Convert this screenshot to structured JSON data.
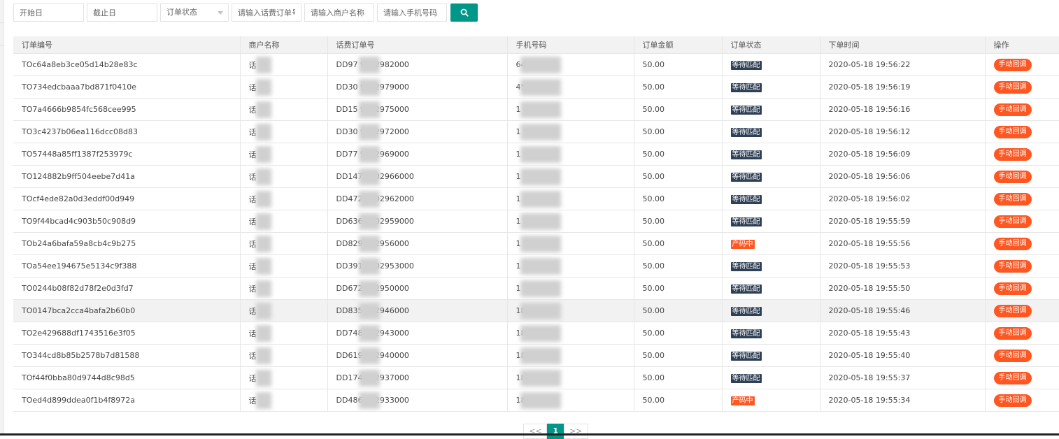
{
  "filters": {
    "start_date_placeholder": "开始日",
    "end_date_placeholder": "截止日",
    "status_select": "订单状态",
    "order_no_placeholder": "请输入话费订单号",
    "merchant_placeholder": "请输入商户名称",
    "phone_placeholder": "请输入手机号码",
    "search_icon": "search-icon"
  },
  "table": {
    "headers": [
      "订单编号",
      "商户名称",
      "话费订单号",
      "手机号码",
      "订单金额",
      "订单状态",
      "下单时间",
      "操作"
    ],
    "rows": [
      {
        "id": "TOc64a8eb3ce05d14b28e83c",
        "merchant": "话",
        "bill": "DD97 9802982000",
        "phone": "6421",
        "amount": "50.00",
        "status": "等待匹配",
        "status_type": "wait",
        "time": "2020-05-18 19:56:22",
        "action": "手动回调"
      },
      {
        "id": "TO734edcbaaa7bd871f0410e",
        "merchant": "话",
        "bill": "DD30 9802979000",
        "phone": "456",
        "amount": "50.00",
        "status": "等待匹配",
        "status_type": "wait",
        "time": "2020-05-18 19:56:19",
        "action": "手动回调"
      },
      {
        "id": "TO7a4666b9854fc568cee995",
        "merchant": "话",
        "bill": "DD15 9802975000",
        "phone": "1 349",
        "amount": "50.00",
        "status": "等待匹配",
        "status_type": "wait",
        "time": "2020-05-18 19:56:16",
        "action": "手动回调"
      },
      {
        "id": "TO3c4237b06ea116dcc08d83",
        "merchant": "话",
        "bill": "DD30 9802972000",
        "phone": "1 985",
        "amount": "50.00",
        "status": "等待匹配",
        "status_type": "wait",
        "time": "2020-05-18 19:56:12",
        "action": "手动回调"
      },
      {
        "id": "TO57448a85ff1387f253979c",
        "merchant": "话",
        "bill": "DD77 9802969000",
        "phone": "1 020",
        "amount": "50.00",
        "status": "等待匹配",
        "status_type": "wait",
        "time": "2020-05-18 19:56:09",
        "action": "手动回调"
      },
      {
        "id": "TO124882b9ff504eebe7d41a",
        "merchant": "话",
        "bill": "DD147 9802966000",
        "phone": "1 332",
        "amount": "50.00",
        "status": "等待匹配",
        "status_type": "wait",
        "time": "2020-05-18 19:56:06",
        "action": "手动回调"
      },
      {
        "id": "TOcf4ede82a0d3eddf00d949",
        "merchant": "话",
        "bill": "DD472 9802962000",
        "phone": "1 43",
        "amount": "50.00",
        "status": "等待匹配",
        "status_type": "wait",
        "time": "2020-05-18 19:56:02",
        "action": "手动回调"
      },
      {
        "id": "TO9f44bcad4c903b50c908d9",
        "merchant": "话",
        "bill": "DD636 9802959000",
        "phone": "1 28",
        "amount": "50.00",
        "status": "等待匹配",
        "status_type": "wait",
        "time": "2020-05-18 19:55:59",
        "action": "手动回调"
      },
      {
        "id": "TOb24a6bafa59a8cb4c9b275",
        "merchant": "话",
        "bill": "DD829 802956000",
        "phone": "1 5",
        "amount": "50.00",
        "status": "产码中",
        "status_type": "risk",
        "time": "2020-05-18 19:55:56",
        "action": "手动回调"
      },
      {
        "id": "TOa54ee194675e5134c9f388",
        "merchant": "话",
        "bill": "DD3915 802953000",
        "phone": "1 5",
        "amount": "50.00",
        "status": "等待匹配",
        "status_type": "wait",
        "time": "2020-05-18 19:55:53",
        "action": "手动回调"
      },
      {
        "id": "TO0244b08f82d78f2e0d3fd7",
        "merchant": "话",
        "bill": "DD672 802950000",
        "phone": "1",
        "amount": "50.00",
        "status": "等待匹配",
        "status_type": "wait",
        "time": "2020-05-18 19:55:50",
        "action": "手动回调"
      },
      {
        "id": "TO0147bca2cca4bafa2b60b0",
        "merchant": "话",
        "bill": "DD835 802946000",
        "phone": "18",
        "amount": "50.00",
        "status": "等待匹配",
        "status_type": "wait",
        "time": "2020-05-18 19:55:46",
        "action": "手动回调"
      },
      {
        "id": "TO2e429688df1743516e3f05",
        "merchant": "话",
        "bill": "DD748 802943000",
        "phone": "18",
        "amount": "50.00",
        "status": "等待匹配",
        "status_type": "wait",
        "time": "2020-05-18 19:55:43",
        "action": "手动回调"
      },
      {
        "id": "TO344cd8b85b2578b7d81588",
        "merchant": "话",
        "bill": "DD619 802940000",
        "phone": "18",
        "amount": "50.00",
        "status": "等待匹配",
        "status_type": "wait",
        "time": "2020-05-18 19:55:40",
        "action": "手动回调"
      },
      {
        "id": "TOf44f0bba80d9744d8c98d5",
        "merchant": "话",
        "bill": "DD174 802937000",
        "phone": "18 4",
        "amount": "50.00",
        "status": "等待匹配",
        "status_type": "wait",
        "time": "2020-05-18 19:55:37",
        "action": "手动回调"
      },
      {
        "id": "TOed4d899ddea0f1b4f8972a",
        "merchant": "话",
        "bill": "DD486 802933000",
        "phone": "18 40",
        "amount": "50.00",
        "status": "产码中",
        "status_type": "risk",
        "time": "2020-05-18 19:55:34",
        "action": "手动回调"
      }
    ],
    "highlighted_row": 11
  },
  "pagination": {
    "prev": "<<",
    "current": "1",
    "next": ">>"
  },
  "colors": {
    "primary": "#009688",
    "danger": "#ff5722",
    "waiting": "#2f4056"
  }
}
